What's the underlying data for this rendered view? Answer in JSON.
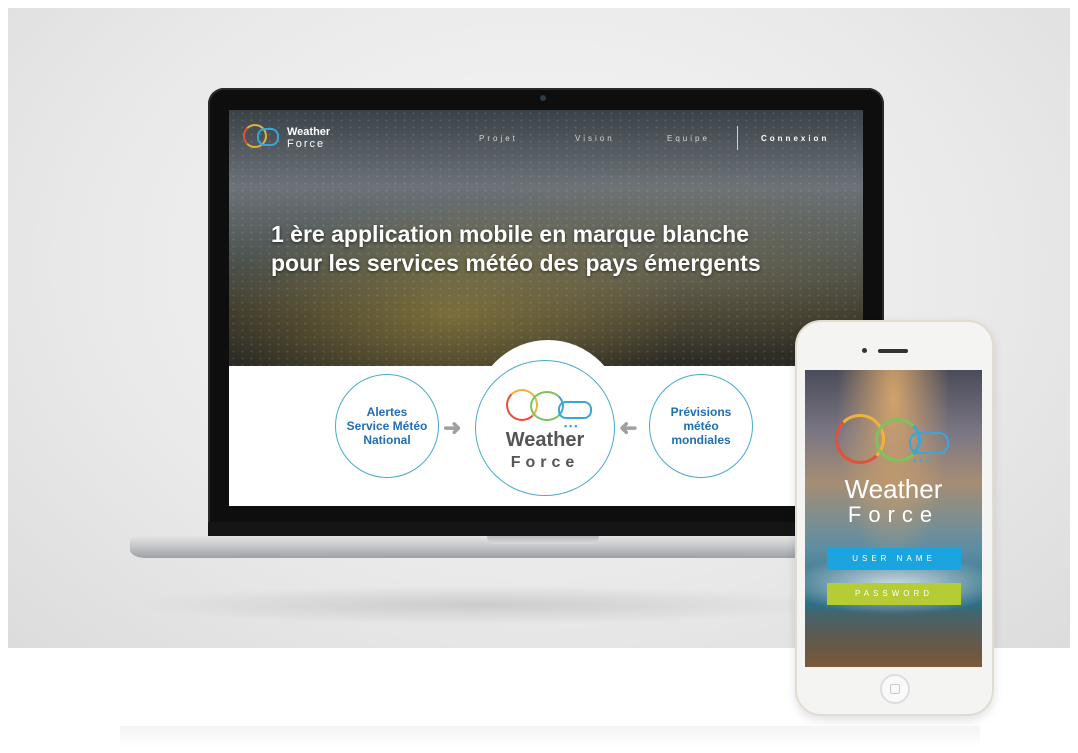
{
  "site": {
    "logo": {
      "line1": "Weather",
      "line2": "Force"
    },
    "nav": [
      "Projet",
      "Vision",
      "Equipe"
    ],
    "login": "Connexion",
    "headline_line1": "1 ère application mobile en marque blanche",
    "headline_line2": "pour les services météo des pays émergents",
    "left_circle": [
      "Alertes",
      "Service Météo",
      "National"
    ],
    "center_logo": {
      "line1": "Weather",
      "line2": "Force"
    },
    "right_circle": [
      "Prévisions",
      "météo",
      "mondiales"
    ],
    "arrow_glyph": "➜"
  },
  "phone": {
    "logo": {
      "line1": "Weather",
      "line2": "Force"
    },
    "username_placeholder": "USER NAME",
    "password_placeholder": "PASSWORD"
  },
  "colors": {
    "brand_blue": "#1f6fb2",
    "username_field": "#1aa4e0",
    "password_field": "#b6cc34",
    "logo_orange": "#efb23b",
    "logo_red": "#e5503a",
    "logo_green": "#7cc35a",
    "logo_cyan": "#38a8d8"
  }
}
